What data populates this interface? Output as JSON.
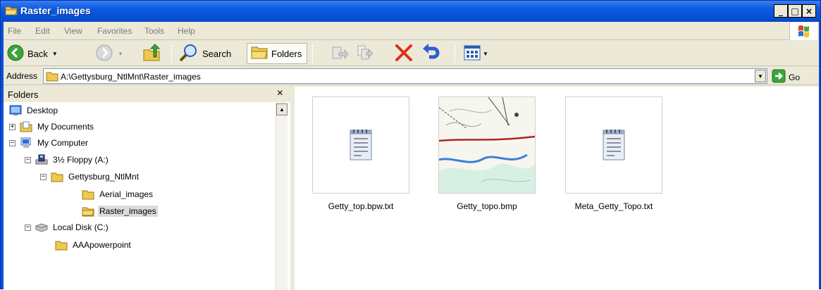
{
  "window": {
    "title": "Raster_images"
  },
  "menu": [
    "File",
    "Edit",
    "View",
    "Favorites",
    "Tools",
    "Help"
  ],
  "toolbar": {
    "back_label": "Back",
    "search_label": "Search",
    "folders_label": "Folders"
  },
  "address": {
    "label": "Address",
    "value": "A:\\Gettysburg_NtlMnt\\Raster_images",
    "go_label": "Go"
  },
  "folders_pane": {
    "title": "Folders",
    "close": "×",
    "tree": [
      {
        "label": "Desktop"
      },
      {
        "label": "My Documents",
        "toggle": "+"
      },
      {
        "label": "My Computer",
        "toggle": "−"
      },
      {
        "label": "3½ Floppy (A:)",
        "toggle": "−"
      },
      {
        "label": "Gettysburg_NtlMnt",
        "toggle": "−"
      },
      {
        "label": "Aerial_images"
      },
      {
        "label": "Raster_images",
        "selected": true
      },
      {
        "label": "Local Disk (C:)",
        "toggle": "−"
      },
      {
        "label": "AAApowerpoint"
      }
    ]
  },
  "files": [
    {
      "name": "Getty_top.bpw.txt",
      "icon": "notepad-document-icon"
    },
    {
      "name": "Getty_topo.bmp",
      "icon": "topographic-map-thumbnail"
    },
    {
      "name": "Meta_Getty_Topo.txt",
      "icon": "notepad-document-icon"
    }
  ],
  "colors": {
    "title_bar": "#0a5ae0",
    "chrome": "#ece9d8",
    "selection": "#dcdcdc"
  }
}
